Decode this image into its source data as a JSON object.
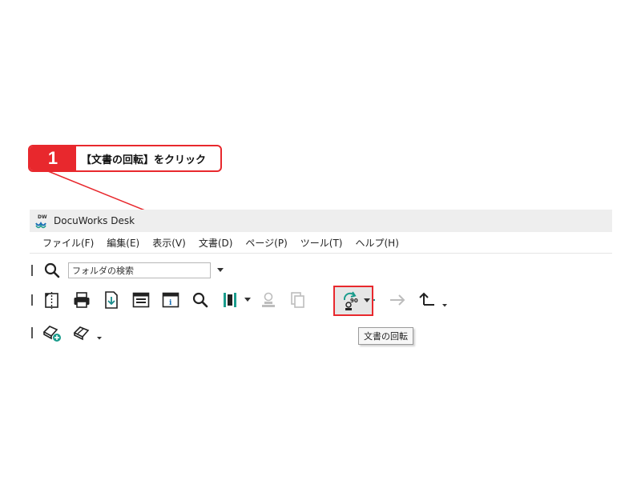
{
  "callout": {
    "number": "1",
    "text": "【文書の回転】をクリック",
    "color": "#e8282d"
  },
  "window": {
    "title": "DocuWorks Desk",
    "logo_label": "DW",
    "accent_color": "#1a9c8c"
  },
  "menu": [
    {
      "label": "ファイル(F)"
    },
    {
      "label": "編集(E)"
    },
    {
      "label": "表示(V)"
    },
    {
      "label": "文書(D)"
    },
    {
      "label": "ページ(P)"
    },
    {
      "label": "ツール(T)"
    },
    {
      "label": "ヘルプ(H)"
    }
  ],
  "search": {
    "placeholder": "フォルダの検索",
    "icon": "search-icon"
  },
  "toolbar": {
    "icons": [
      "split-document-icon",
      "print-icon",
      "download-icon",
      "viewer-icon",
      "properties-icon",
      "search-icon",
      "binder-icon",
      "stamp-icon",
      "copy-pages-icon",
      "rotate-document-icon",
      "back-arrow-icon",
      "forward-arrow-icon",
      "up-folder-icon"
    ],
    "rotate_badge": "90",
    "rotate_tooltip": "文書の回転"
  },
  "toolbar2": {
    "icons": [
      "eraser-add-icon",
      "eraser-icon"
    ]
  }
}
